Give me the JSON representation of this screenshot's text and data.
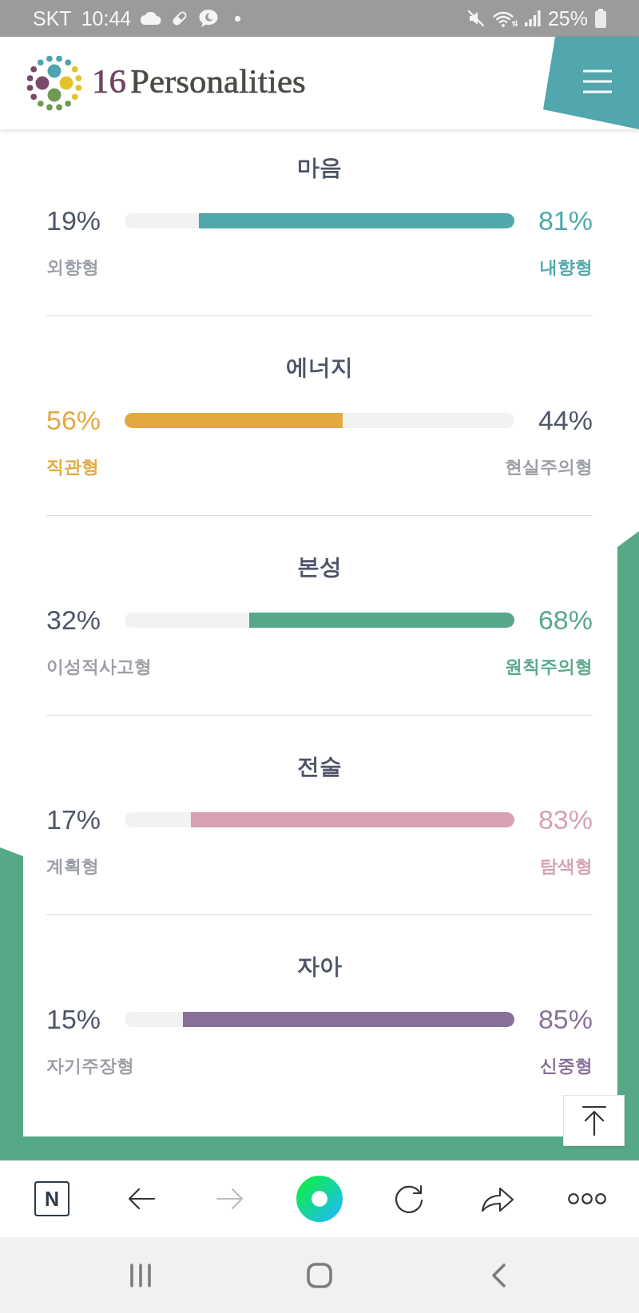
{
  "status_bar": {
    "carrier": "SKT",
    "time": "10:44",
    "battery": "25%"
  },
  "header": {
    "logo": {
      "number": "16",
      "name": "Personalities"
    }
  },
  "traits": [
    {
      "title": "마음",
      "color": "#4fa8ab",
      "level": 0.81,
      "left": {
        "percent": "19%",
        "label": "외향형",
        "dominant": false
      },
      "right": {
        "percent": "81%",
        "label": "내향형",
        "dominant": true
      }
    },
    {
      "title": "에너지",
      "color": "#e3a83f",
      "level": 0.56,
      "left": {
        "percent": "56%",
        "label": "직관형",
        "dominant": true
      },
      "right": {
        "percent": "44%",
        "label": "현실주의형",
        "dominant": false
      }
    },
    {
      "title": "본성",
      "color": "#56a988",
      "level": 0.68,
      "left": {
        "percent": "32%",
        "label": "이성적사고형",
        "dominant": false
      },
      "right": {
        "percent": "68%",
        "label": "원칙주의형",
        "dominant": true
      }
    },
    {
      "title": "전술",
      "color": "#d6a0b5",
      "level": 0.83,
      "left": {
        "percent": "17%",
        "label": "계획형",
        "dominant": false
      },
      "right": {
        "percent": "83%",
        "label": "탐색형",
        "dominant": true
      }
    },
    {
      "title": "자아",
      "color": "#887198",
      "level": 0.85,
      "left": {
        "percent": "15%",
        "label": "자기주장형",
        "dominant": false
      },
      "right": {
        "percent": "85%",
        "label": "신중형",
        "dominant": true
      }
    }
  ],
  "browser_toolbar": [
    {
      "kind": "logo",
      "text": "N",
      "disabled": false
    },
    {
      "kind": "back",
      "disabled": false
    },
    {
      "kind": "forward",
      "disabled": true
    },
    {
      "kind": "ring",
      "disabled": false
    },
    {
      "kind": "reload",
      "disabled": false
    },
    {
      "kind": "share",
      "disabled": false
    },
    {
      "kind": "more",
      "disabled": false
    }
  ]
}
